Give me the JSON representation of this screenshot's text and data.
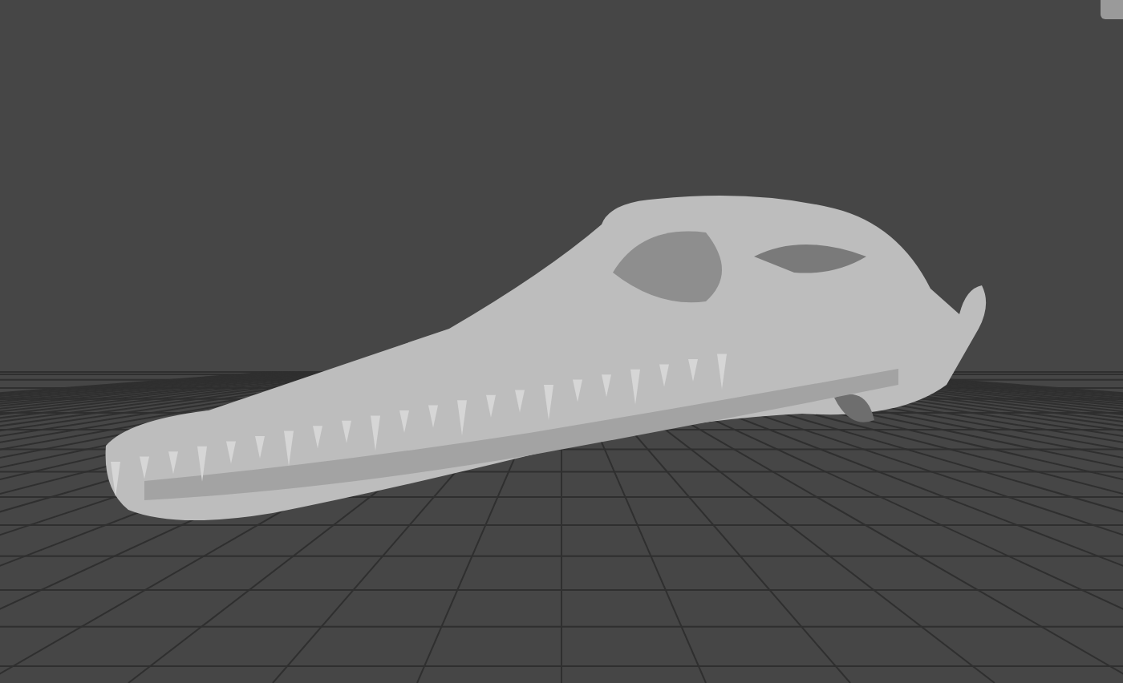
{
  "viewport": {
    "grid": true,
    "model_visible": true,
    "corner_panel": true
  }
}
